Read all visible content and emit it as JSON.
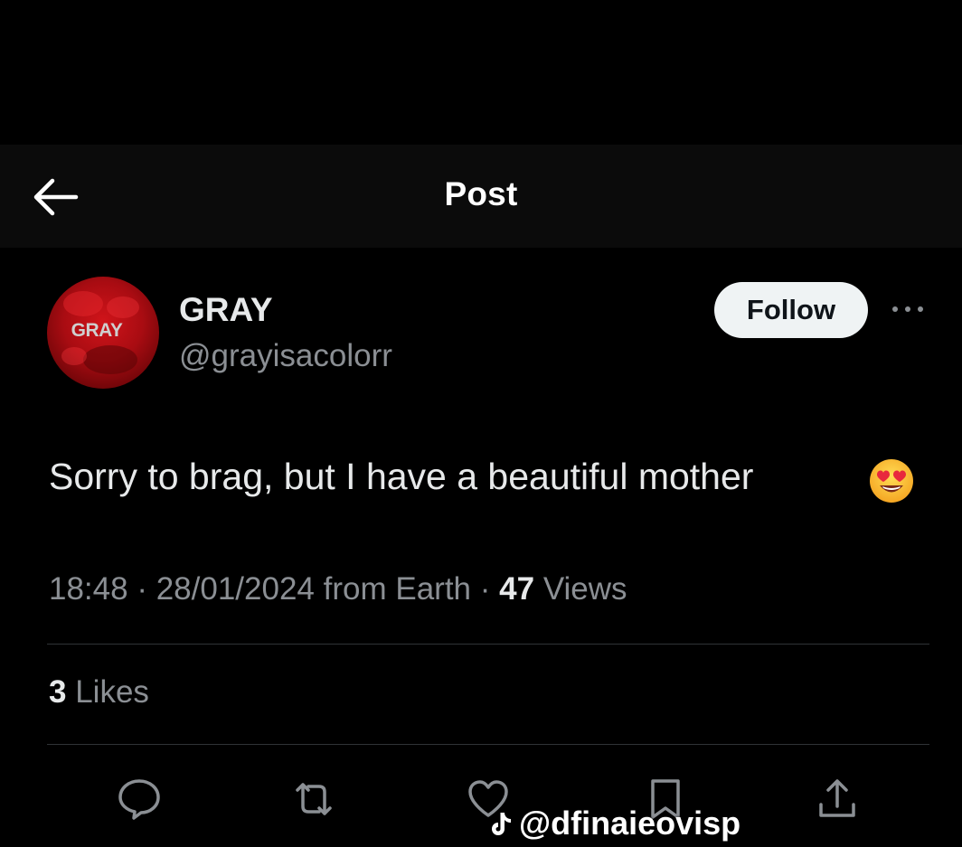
{
  "header": {
    "title": "Post",
    "back_icon": "arrow-left-icon"
  },
  "author": {
    "avatar_text": "GRAY",
    "display_name": "GRAY",
    "handle": "@grayisacolorr",
    "follow_label": "Follow",
    "more_icon": "more-horizontal-icon"
  },
  "tweet": {
    "text": "Sorry to brag, but I have a beautiful mother",
    "emoji": "smiling-face-with-heart-eyes",
    "time": "18:48",
    "date": "28/01/2024",
    "source": "from Earth",
    "views_count": "47",
    "views_label": "Views",
    "likes_count": "3",
    "likes_label": "Likes"
  },
  "actions": [
    {
      "name": "reply",
      "icon": "reply-icon"
    },
    {
      "name": "repost",
      "icon": "repost-icon"
    },
    {
      "name": "like",
      "icon": "heart-icon"
    },
    {
      "name": "bookmark",
      "icon": "bookmark-icon"
    },
    {
      "name": "share",
      "icon": "share-icon"
    }
  ],
  "watermark": {
    "text": "@dfinaieovisp"
  },
  "colors": {
    "background": "#000000",
    "header_bg": "#0b0b0b",
    "primary_text": "#e7e9ea",
    "secondary_text": "#8b8f94",
    "follow_bg": "#eff3f4",
    "avatar_red": "#c3121a"
  }
}
